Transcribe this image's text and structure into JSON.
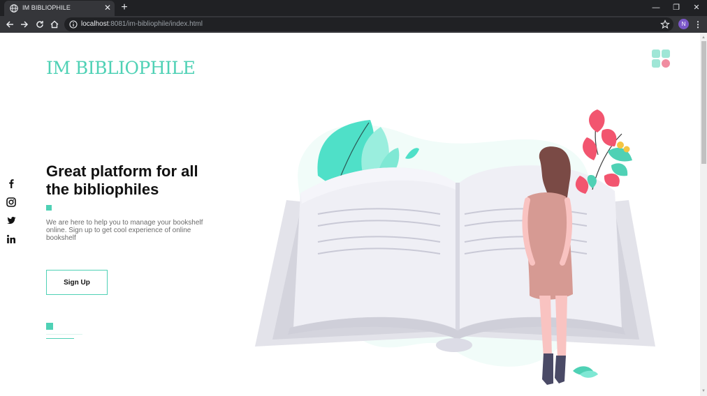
{
  "browser": {
    "tab_title": "IM BIBLIOPHILE",
    "tab_close": "✕",
    "new_tab": "+",
    "window_controls": {
      "minimize": "—",
      "restore": "❐",
      "close": "✕"
    },
    "url_host": "localhost",
    "url_rest": ":8081/im-bibliophile/index.html",
    "profile_initial": "N",
    "menu": "⋮"
  },
  "page": {
    "logo": "IM BIBLIOPHILE",
    "headline": "Great platform for all the bibliophiles",
    "description": "We are here to help you to manage your bookshelf online. Sign up to get cool experience of online bookshelf",
    "signup_label": "Sign Up"
  },
  "social": [
    "facebook-icon",
    "instagram-icon",
    "twitter-icon",
    "linkedin-icon"
  ],
  "colors": {
    "accent": "#4fd1b5",
    "chrome_dark": "#202124",
    "chrome_tab": "#35363a",
    "pink": "#f2556f",
    "book_page": "#efeff5"
  }
}
